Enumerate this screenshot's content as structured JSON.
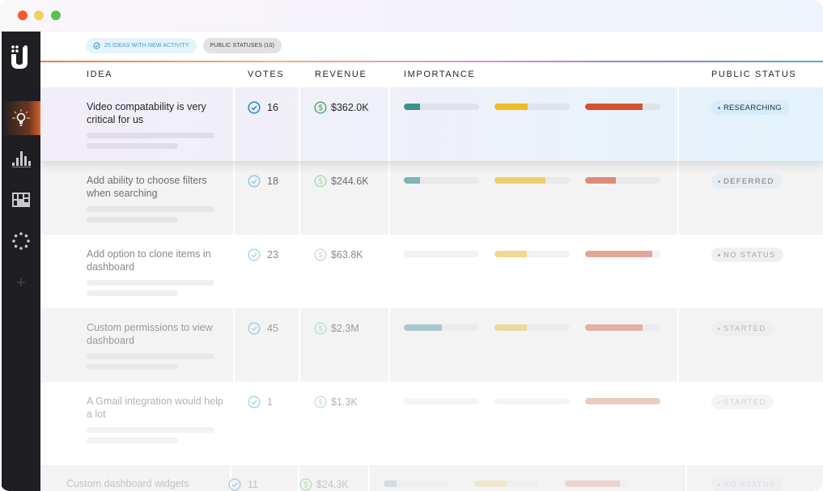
{
  "window": {
    "controls": [
      "close",
      "minimize",
      "maximize"
    ]
  },
  "sidebar": {
    "logo": "app-logo",
    "items": [
      {
        "name": "ideas",
        "icon": "lightbulb-icon",
        "active": true
      },
      {
        "name": "analytics",
        "icon": "bar-chart-icon",
        "active": false
      },
      {
        "name": "board",
        "icon": "board-grid-icon",
        "active": false
      },
      {
        "name": "loading",
        "icon": "dotted-circle-icon",
        "active": false
      },
      {
        "name": "add",
        "icon": "plus-icon",
        "active": false
      }
    ]
  },
  "toolbar": {
    "activity_chip": "25 IDEAS WITH NEW ACTIVITY",
    "statuses_chip": "PUBLIC STATUSES (10)"
  },
  "table": {
    "headers": {
      "idea": "IDEA",
      "votes": "VOTES",
      "revenue": "REVENUE",
      "importance": "IMPORTANCE",
      "public_status": "PUBLIC STATUS"
    },
    "importance_colors": [
      "#3e9193",
      "#efbd1f",
      "#d4522d"
    ],
    "rows": [
      {
        "idea": "Video compatability is very critical for us",
        "votes": "16",
        "revenue": "$362.0K",
        "importance": [
          0.22,
          0.44,
          0.76
        ],
        "status": "RESEARCHING",
        "status_color": "#2f8fc4"
      },
      {
        "idea": "Add ability to choose filters when searching",
        "votes": "18",
        "revenue": "$244.6K",
        "importance": [
          0.22,
          0.68,
          0.41
        ],
        "status": "DEFERRED",
        "status_color": "#5fb2e0"
      },
      {
        "idea": "Add option to clone items in dashboard",
        "votes": "23",
        "revenue": "$63.8K",
        "importance": [
          0.0,
          0.43,
          0.89
        ],
        "status": "NO STATUS",
        "status_color": "#8c8c92"
      },
      {
        "idea": "Custom permissions to view dashboard",
        "votes": "45",
        "revenue": "$2.3M",
        "importance": [
          0.5,
          0.43,
          0.76
        ],
        "status": "STARTED",
        "status_color": "#9fc9a6"
      },
      {
        "idea": "A Gmail integration would help a lot",
        "votes": "1",
        "revenue": "$1.3K",
        "importance": [
          0.0,
          0.0,
          1.0
        ],
        "status": "STARTED",
        "status_color": "#b9d8be"
      },
      {
        "idea": "Custom dashboard widgets",
        "votes": "11",
        "revenue": "$24.3K",
        "importance": [
          0.2,
          0.5,
          0.85
        ],
        "status": "NO STATUS",
        "status_color": "#c7c7cb"
      }
    ]
  }
}
